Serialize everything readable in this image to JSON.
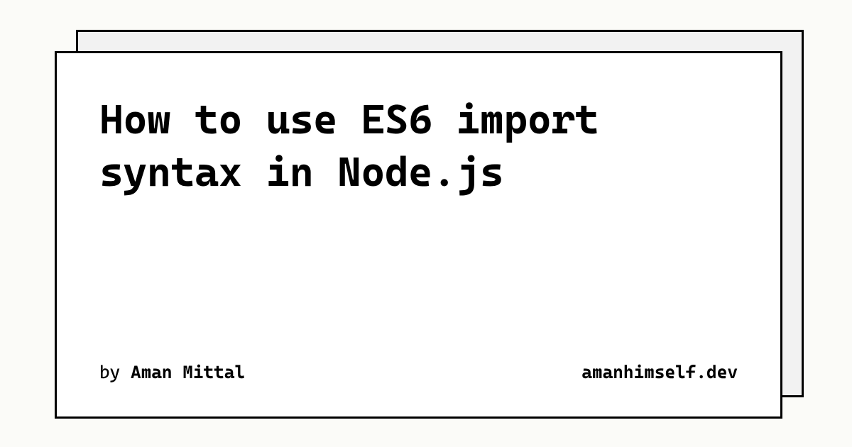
{
  "card": {
    "title": "How to use ES6 import syntax in Node.js",
    "byline_prefix": "by ",
    "author": "Aman Mittal",
    "site": "amanhimself.dev"
  }
}
